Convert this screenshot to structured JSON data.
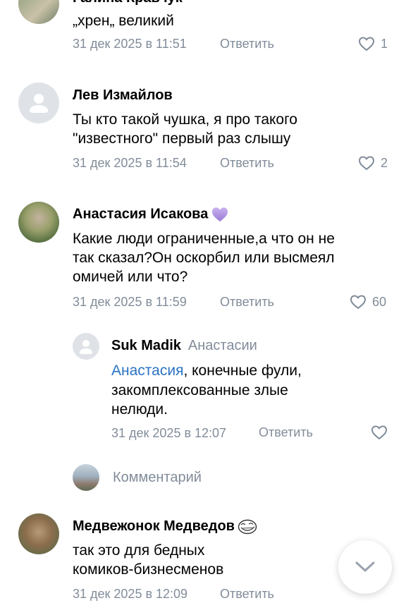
{
  "comments": [
    {
      "author": "Галина Кравчук",
      "text": "„хрен„ великий",
      "date": "31 дек 2025 в 11:51",
      "reply_label": "Ответить",
      "likes": "1"
    },
    {
      "author": "Лев Измайлов",
      "text_line1": "Ты кто такой чушка, я про такого",
      "text_line2": "\"известного\" первый раз слышу",
      "date": "31 дек 2025 в 11:54",
      "reply_label": "Ответить",
      "likes": "2"
    },
    {
      "author": "Анастасия Исакова",
      "text_line1": "Какие люди ограниченные,а что он не",
      "text_line2": "так сказал?Он оскорбил или высмеял",
      "text_line3": "омичей или что?",
      "date": "31 дек 2025 в 11:59",
      "reply_label": "Ответить",
      "likes": "60"
    },
    {
      "author": "Suk Madik",
      "reply_to": "Анастасии",
      "mention": "Анастасия",
      "text_line1_rest": ", конечные фули,",
      "text_line2": "закомплексованные злые",
      "text_line3": "нелюди.",
      "date": "31 дек 2025 в 12:07",
      "reply_label": "Ответить"
    },
    {
      "author": "Медвежонок Медведов",
      "text_line1": "так это для бедных",
      "text_line2": "комиков-бизнесменов",
      "date": "31 дек 2025 в 12:09",
      "reply_label": "Ответить"
    }
  ],
  "compose": {
    "placeholder": "Комментарий"
  },
  "colors": {
    "meta": "#818c99",
    "mention": "#2a73c4",
    "placeholder_avatar": "#dfe3e8"
  },
  "icons": {
    "like": "heart-outline-icon",
    "scroll": "chevron-down-icon",
    "badge": "purple-heart-icon",
    "emoji": "troll-face-icon"
  }
}
